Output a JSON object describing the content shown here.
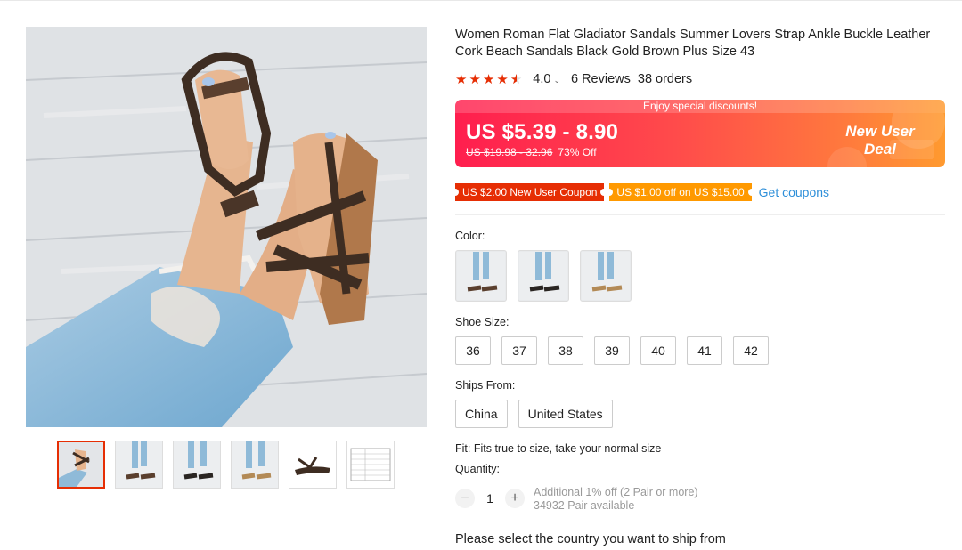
{
  "product": {
    "title": "Women Roman Flat Gladiator Sandals Summer Lovers Strap Ankle Buckle Leather Cork Beach Sandals Black Gold Brown Plus Size 43",
    "rating": {
      "stars": 4.0,
      "score": "4.0",
      "reviews": "6 Reviews",
      "orders": "38 orders"
    }
  },
  "price": {
    "banner_top": "Enjoy special discounts!",
    "current": "US $5.39 - 8.90",
    "original": "US $19.98 - 32.96",
    "discount": "73% Off",
    "new_user_deal": "New User Deal"
  },
  "coupons": {
    "items": [
      "US $2.00 New User Coupon",
      "US $1.00 off on US $15.00"
    ],
    "get_link": "Get coupons"
  },
  "color": {
    "label": "Color:"
  },
  "size": {
    "label": "Shoe Size:",
    "options": [
      "36",
      "37",
      "38",
      "39",
      "40",
      "41",
      "42"
    ]
  },
  "ships": {
    "label": "Ships From:",
    "options": [
      "China",
      "United States"
    ]
  },
  "fit": "Fit: Fits true to size, take your normal size",
  "quantity": {
    "label": "Quantity:",
    "value": "1",
    "minus": "−",
    "plus": "+",
    "note_line1": "Additional 1% off (2 Pair or more)",
    "note_line2": "34932 Pair available"
  },
  "ship_message": "Please select the country you want to ship from",
  "colors": {
    "accent": "#e62e04",
    "link": "#2e8fd9",
    "coupon_orange": "#ff9900"
  }
}
